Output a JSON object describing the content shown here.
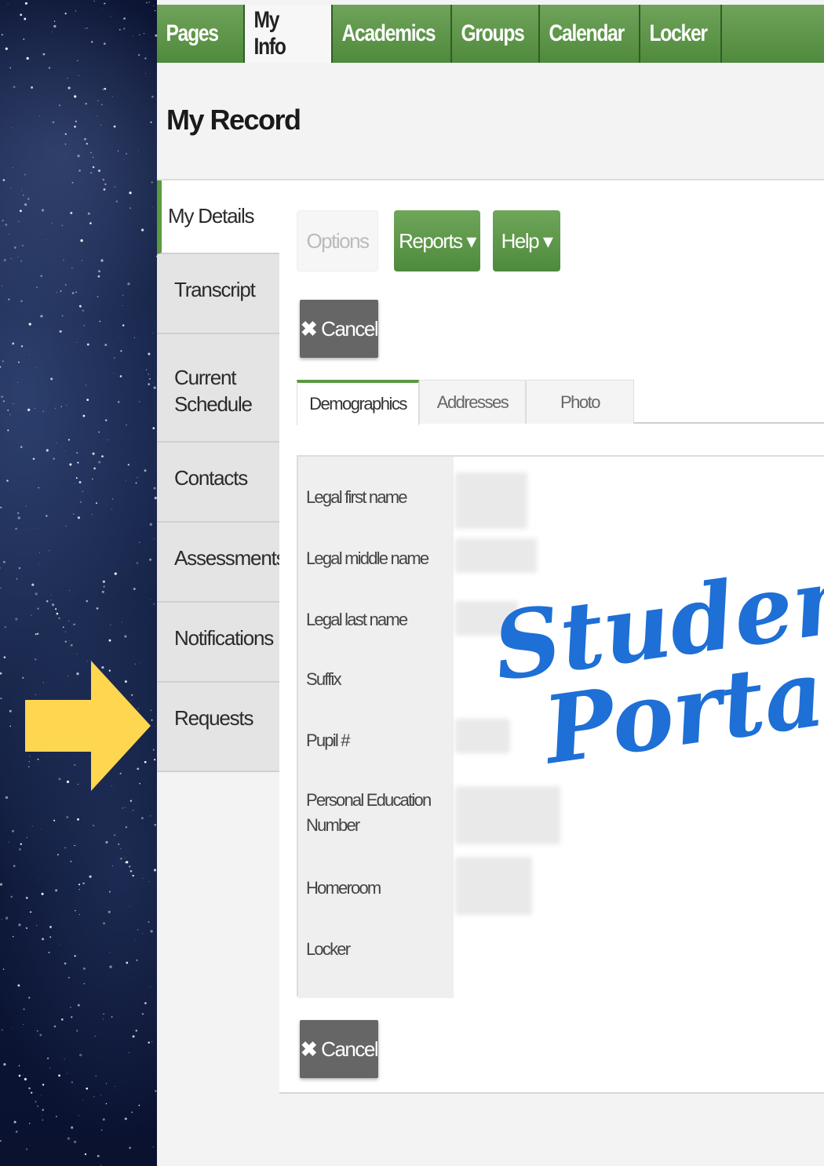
{
  "top_nav": {
    "tabs": [
      "Pages",
      "My Info",
      "Academics",
      "Groups",
      "Calendar",
      "Locker"
    ],
    "active_index": 1
  },
  "page_title": "My Record",
  "side_nav": {
    "items": [
      "My Details",
      "Transcript",
      "Current Schedule",
      "Contacts",
      "Assessments",
      "Notifications",
      "Requests"
    ],
    "active_index": 0
  },
  "toolbar": {
    "options_label": "Options",
    "reports_label": "Reports ▾",
    "help_label": "Help ▾"
  },
  "cancel_label": "Cancel",
  "subtabs": [
    "Demographics",
    "Addresses",
    "Photo"
  ],
  "fields": [
    "Legal first name",
    "Legal middle name",
    "Legal last name",
    "Suffix",
    "Pupil #",
    "Personal Education Number",
    "Homeroom",
    "Locker"
  ],
  "overlay": {
    "line1": "Student",
    "line2": "Portal",
    "arrow_color": "#ffd64f",
    "script_color": "#1e6fd6"
  }
}
